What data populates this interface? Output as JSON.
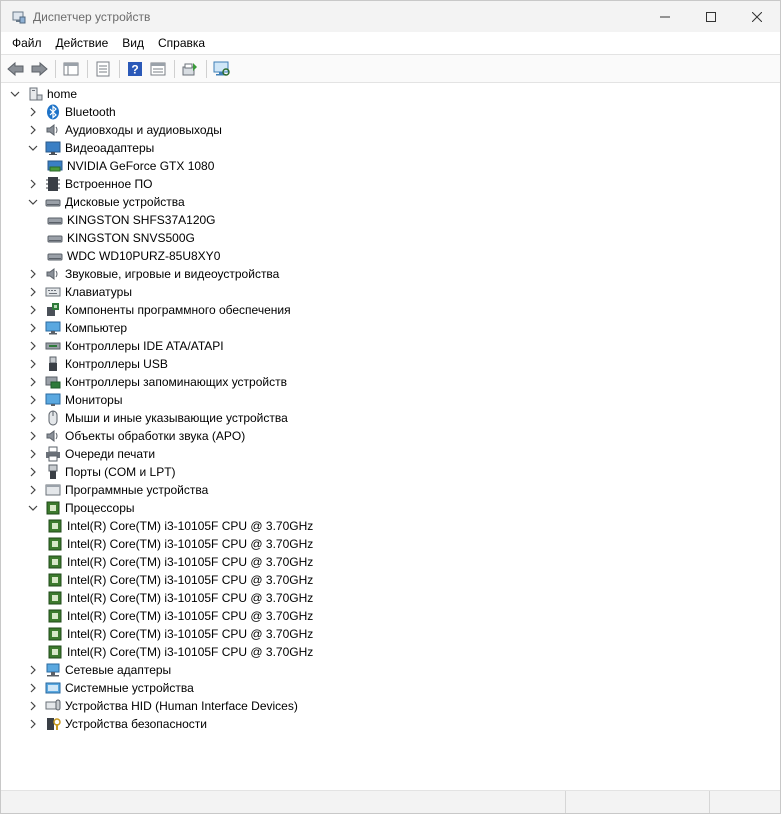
{
  "window": {
    "title": "Диспетчер устройств"
  },
  "menu": [
    "Файл",
    "Действие",
    "Вид",
    "Справка"
  ],
  "toolbar": {
    "buttons": [
      "back-icon",
      "forward-icon",
      "show-hide-tree-icon",
      "properties-icon",
      "help-icon",
      "view-icon",
      "update-driver-icon",
      "scan-hardware-icon"
    ]
  },
  "tree": {
    "root": "home",
    "categories": [
      {
        "label": "Bluetooth",
        "icon": "bluetooth-icon",
        "expanded": false,
        "children": []
      },
      {
        "label": "Аудиовходы и аудиовыходы",
        "icon": "speaker-icon",
        "expanded": false,
        "children": []
      },
      {
        "label": "Видеоадаптеры",
        "icon": "display-adapter-icon",
        "expanded": true,
        "children": [
          "NVIDIA GeForce GTX 1080"
        ]
      },
      {
        "label": "Встроенное ПО",
        "icon": "firmware-icon",
        "expanded": false,
        "children": []
      },
      {
        "label": "Дисковые устройства",
        "icon": "disk-icon",
        "expanded": true,
        "children": [
          "KINGSTON SHFS37A120G",
          "KINGSTON SNVS500G",
          "WDC WD10PURZ-85U8XY0"
        ]
      },
      {
        "label": "Звуковые, игровые и видеоустройства",
        "icon": "sound-icon",
        "expanded": false,
        "children": []
      },
      {
        "label": "Клавиатуры",
        "icon": "keyboard-icon",
        "expanded": false,
        "children": []
      },
      {
        "label": "Компоненты программного обеспечения",
        "icon": "software-component-icon",
        "expanded": false,
        "children": []
      },
      {
        "label": "Компьютер",
        "icon": "computer-icon",
        "expanded": false,
        "children": []
      },
      {
        "label": "Контроллеры IDE ATA/ATAPI",
        "icon": "ide-controller-icon",
        "expanded": false,
        "children": []
      },
      {
        "label": "Контроллеры USB",
        "icon": "usb-icon",
        "expanded": false,
        "children": []
      },
      {
        "label": "Контроллеры запоминающих устройств",
        "icon": "storage-controller-icon",
        "expanded": false,
        "children": []
      },
      {
        "label": "Мониторы",
        "icon": "monitor-icon",
        "expanded": false,
        "children": []
      },
      {
        "label": "Мыши и иные указывающие устройства",
        "icon": "mouse-icon",
        "expanded": false,
        "children": []
      },
      {
        "label": "Объекты обработки звука (APO)",
        "icon": "audio-processing-icon",
        "expanded": false,
        "children": []
      },
      {
        "label": "Очереди печати",
        "icon": "printer-icon",
        "expanded": false,
        "children": []
      },
      {
        "label": "Порты (COM и LPT)",
        "icon": "port-icon",
        "expanded": false,
        "children": []
      },
      {
        "label": "Программные устройства",
        "icon": "software-device-icon",
        "expanded": false,
        "children": []
      },
      {
        "label": "Процессоры",
        "icon": "processor-icon",
        "expanded": true,
        "children": [
          "Intel(R) Core(TM) i3-10105F CPU @ 3.70GHz",
          "Intel(R) Core(TM) i3-10105F CPU @ 3.70GHz",
          "Intel(R) Core(TM) i3-10105F CPU @ 3.70GHz",
          "Intel(R) Core(TM) i3-10105F CPU @ 3.70GHz",
          "Intel(R) Core(TM) i3-10105F CPU @ 3.70GHz",
          "Intel(R) Core(TM) i3-10105F CPU @ 3.70GHz",
          "Intel(R) Core(TM) i3-10105F CPU @ 3.70GHz",
          "Intel(R) Core(TM) i3-10105F CPU @ 3.70GHz"
        ]
      },
      {
        "label": "Сетевые адаптеры",
        "icon": "network-adapter-icon",
        "expanded": false,
        "children": []
      },
      {
        "label": "Системные устройства",
        "icon": "system-device-icon",
        "expanded": false,
        "children": []
      },
      {
        "label": "Устройства HID (Human Interface Devices)",
        "icon": "hid-icon",
        "expanded": false,
        "children": []
      },
      {
        "label": "Устройства безопасности",
        "icon": "security-device-icon",
        "expanded": false,
        "children": []
      }
    ]
  },
  "colors": {
    "accent": "#1e73c8",
    "processor_green": "#3d7a2e"
  }
}
